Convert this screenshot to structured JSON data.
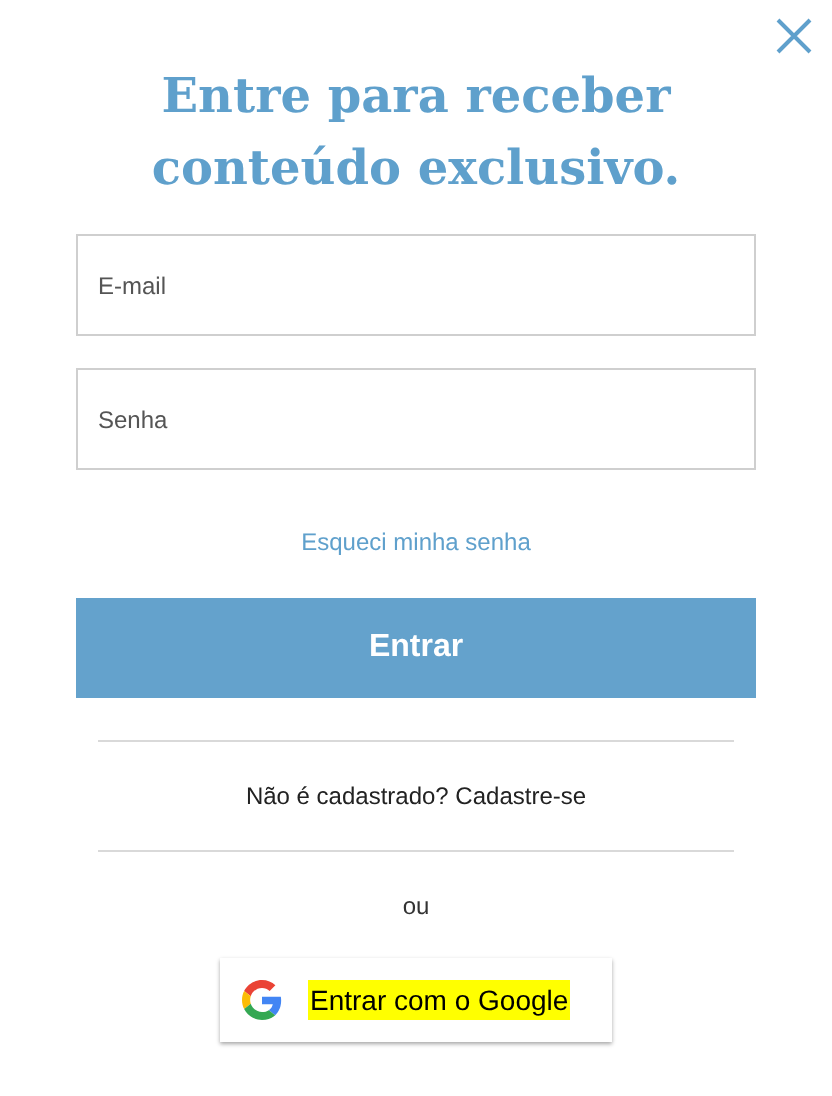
{
  "title": "Entre para receber conteúdo exclusivo.",
  "fields": [
    {
      "placeholder": "E-mail"
    },
    {
      "placeholder": "Senha"
    }
  ],
  "forgot_link": "Esqueci minha senha",
  "submit_button": "Entrar",
  "signup_text": "Não é cadastrado? Cadastre-se",
  "separator": "ou",
  "google_button": {
    "label": "Entrar com o Google",
    "highlighted": true
  }
}
